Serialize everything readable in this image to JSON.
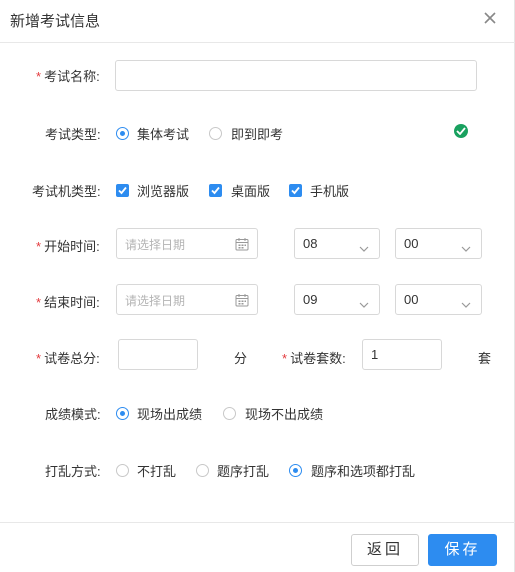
{
  "dialog": {
    "title": "新增考试信息",
    "close_glyph": "×"
  },
  "form": {
    "required_mark": "*",
    "exam_name": {
      "label": "考试名称:",
      "value": ""
    },
    "exam_type": {
      "label": "考试类型:",
      "options": [
        "集体考试",
        "即到即考"
      ],
      "selected": "集体考试",
      "status_icon": "check-circle-icon"
    },
    "exam_client_type": {
      "label": "考试机类型:",
      "options": [
        "浏览器版",
        "桌面版",
        "手机版"
      ],
      "checked": [
        "浏览器版",
        "桌面版",
        "手机版"
      ]
    },
    "start_time": {
      "label": "开始时间:",
      "date_placeholder": "请选择日期",
      "hour": "08",
      "minute": "00"
    },
    "end_time": {
      "label": "结束时间:",
      "date_placeholder": "请选择日期",
      "hour": "09",
      "minute": "00"
    },
    "total_score": {
      "label": "试卷总分:",
      "value": "",
      "unit": "分"
    },
    "paper_sets": {
      "label": "试卷套数:",
      "value": "1",
      "unit": "套"
    },
    "score_mode": {
      "label": "成绩模式:",
      "options": [
        "现场出成绩",
        "现场不出成绩"
      ],
      "selected": "现场出成绩"
    },
    "shuffle_mode": {
      "label": "打乱方式:",
      "options": [
        "不打乱",
        "题序打乱",
        "题序和选项都打乱"
      ],
      "selected": "题序和选项都打乱"
    }
  },
  "footer": {
    "back_label": "返回",
    "save_label": "保存"
  },
  "colors": {
    "primary": "#2d8cf0",
    "required": "#e4393c",
    "success": "#19a15f"
  }
}
